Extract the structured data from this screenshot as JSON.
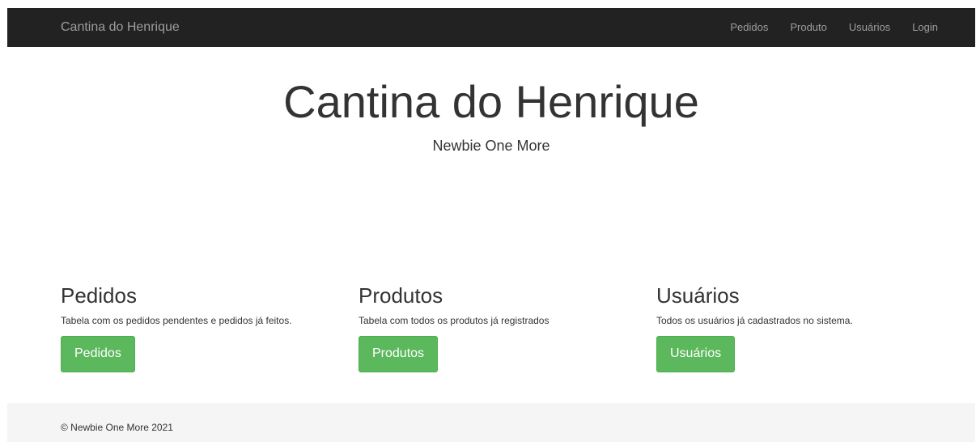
{
  "navbar": {
    "brand": "Cantina do Henrique",
    "links": [
      "Pedidos",
      "Produto",
      "Usuários",
      "Login"
    ]
  },
  "hero": {
    "title": "Cantina do Henrique",
    "subtitle": "Newbie One More"
  },
  "sections": [
    {
      "title": "Pedidos",
      "description": "Tabela com os pedidos pendentes e pedidos já feitos.",
      "button": "Pedidos"
    },
    {
      "title": "Produtos",
      "description": "Tabela com todos os produtos já registrados",
      "button": "Produtos"
    },
    {
      "title": "Usuários",
      "description": "Todos os usuários já cadastrados no sistema.",
      "button": "Usuários"
    }
  ],
  "footer": {
    "text": "© Newbie One More 2021"
  },
  "colors": {
    "navbar_bg": "#222222",
    "nav_text": "#9d9d9d",
    "button_bg": "#5cb85c",
    "footer_bg": "#f5f5f5"
  }
}
